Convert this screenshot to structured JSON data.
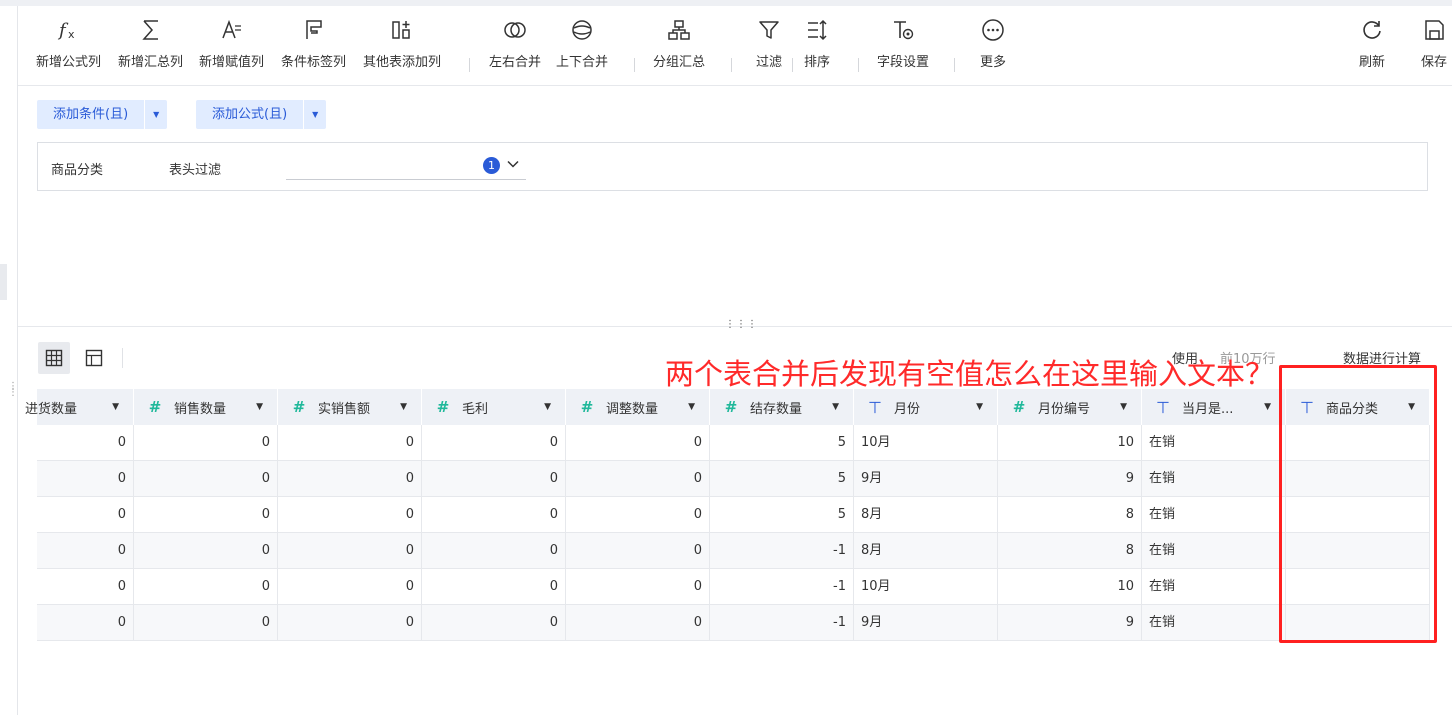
{
  "toolbar": {
    "items": [
      {
        "label": "新增公式列",
        "icon": "formula-icon"
      },
      {
        "label": "新增汇总列",
        "icon": "sigma-icon"
      },
      {
        "label": "新增赋值列",
        "icon": "assign-icon"
      },
      {
        "label": "条件标签列",
        "icon": "flag-icon"
      },
      {
        "label": "其他表添加列",
        "icon": "add-column-icon"
      },
      {
        "label": "左右合并",
        "icon": "merge-horizontal-icon"
      },
      {
        "label": "上下合并",
        "icon": "merge-vertical-icon"
      },
      {
        "label": "分组汇总",
        "icon": "group-icon"
      },
      {
        "label": "过滤",
        "icon": "filter-icon"
      },
      {
        "label": "排序",
        "icon": "sort-icon"
      },
      {
        "label": "字段设置",
        "icon": "field-settings-icon"
      },
      {
        "label": "更多",
        "icon": "more-icon"
      },
      {
        "label": "刷新",
        "icon": "refresh-icon"
      },
      {
        "label": "保存",
        "icon": "save-icon"
      }
    ]
  },
  "filter": {
    "add_condition": "添加条件(且)",
    "add_formula": "添加公式(且)",
    "condition": {
      "field": "商品分类",
      "operator": "表头过滤",
      "badge": "1"
    }
  },
  "table_toolbar": {
    "use_text": "使用",
    "rows_text": "前10万行",
    "calc_text": "数据进行计算"
  },
  "annotation": "两个表合并后发现有空值怎么在这里输入文本？",
  "table": {
    "columns": [
      {
        "name": "进货数量",
        "type": "number"
      },
      {
        "name": "销售数量",
        "type": "number"
      },
      {
        "name": "实销售额",
        "type": "number"
      },
      {
        "name": "毛利",
        "type": "number"
      },
      {
        "name": "调整数量",
        "type": "number"
      },
      {
        "name": "结存数量",
        "type": "number"
      },
      {
        "name": "月份",
        "type": "text"
      },
      {
        "name": "月份编号",
        "type": "number"
      },
      {
        "name": "当月是...",
        "type": "text"
      },
      {
        "name": "商品分类",
        "type": "text"
      }
    ],
    "rows": [
      [
        "0",
        "0",
        "0",
        "0",
        "0",
        "5",
        "10月",
        "10",
        "在销",
        ""
      ],
      [
        "0",
        "0",
        "0",
        "0",
        "0",
        "5",
        "9月",
        "9",
        "在销",
        ""
      ],
      [
        "0",
        "0",
        "0",
        "0",
        "0",
        "5",
        "8月",
        "8",
        "在销",
        ""
      ],
      [
        "0",
        "0",
        "0",
        "0",
        "0",
        "-1",
        "8月",
        "8",
        "在销",
        ""
      ],
      [
        "0",
        "0",
        "0",
        "0",
        "0",
        "-1",
        "10月",
        "10",
        "在销",
        ""
      ],
      [
        "0",
        "0",
        "0",
        "0",
        "0",
        "-1",
        "9月",
        "9",
        "在销",
        ""
      ]
    ]
  },
  "colors": {
    "accent": "#2a5bd7",
    "number_type": "#1fb89a",
    "annotation": "#ff2a2a"
  }
}
